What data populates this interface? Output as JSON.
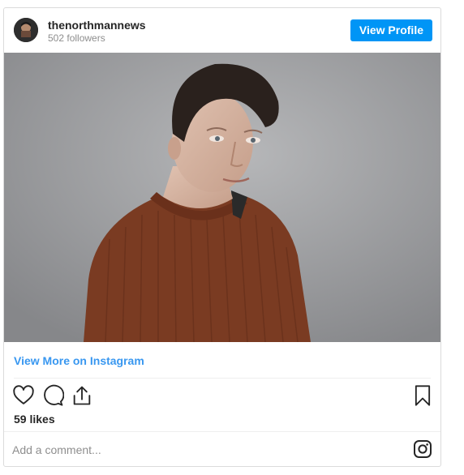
{
  "post": {
    "username": "thenorthmannews",
    "followers": "502 followers",
    "view_profile_label": "View Profile",
    "view_more_label": "View More on Instagram",
    "likes": "59 likes",
    "comment_placeholder": "Add a comment...",
    "icons": [
      "heart-icon",
      "comment-icon",
      "share-icon",
      "bookmark-icon",
      "instagram-icon"
    ],
    "colors": {
      "accent": "#0095f6",
      "link": "#3897f0",
      "sweater": "#7a3b22",
      "backdrop": "#9c9d9f"
    }
  }
}
